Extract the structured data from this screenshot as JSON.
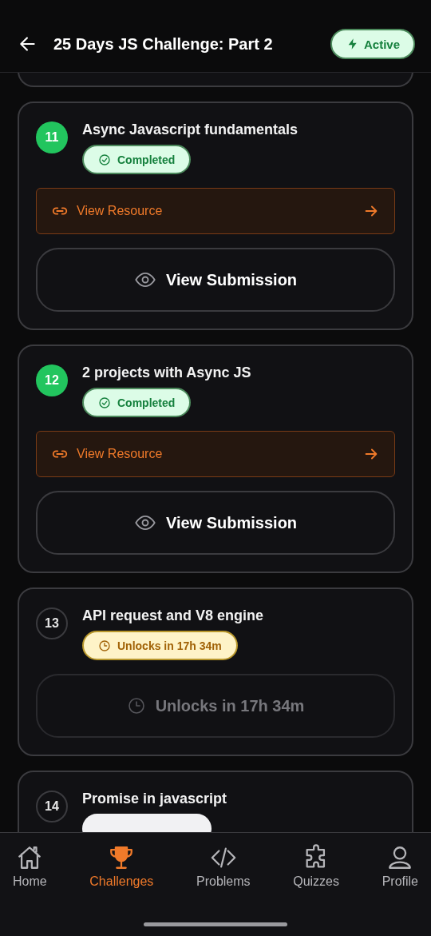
{
  "header": {
    "title": "25 Days JS Challenge: Part 2",
    "badge": "Active"
  },
  "tasks": [
    {
      "number": "11",
      "title": "Async Javascript fundamentals",
      "kind": "completed",
      "badge": "Completed",
      "resource": "View Resource",
      "action": "View Submission"
    },
    {
      "number": "12",
      "title": "2 projects with Async JS",
      "kind": "completed",
      "badge": "Completed",
      "resource": "View Resource",
      "action": "View Submission"
    },
    {
      "number": "13",
      "title": "API request and V8 engine",
      "kind": "locked",
      "badge": "Unlocks in 17h 34m",
      "action": "Unlocks in 17h 34m"
    },
    {
      "number": "14",
      "title": "Promise in javascript",
      "kind": "hidden"
    }
  ],
  "nav": [
    {
      "label": "Home",
      "kind": "home",
      "selected": false
    },
    {
      "label": "Challenges",
      "kind": "trophy",
      "selected": true
    },
    {
      "label": "Problems",
      "kind": "code",
      "selected": false
    },
    {
      "label": "Quizzes",
      "kind": "puzzle",
      "selected": false
    },
    {
      "label": "Profile",
      "kind": "person",
      "selected": false
    }
  ]
}
